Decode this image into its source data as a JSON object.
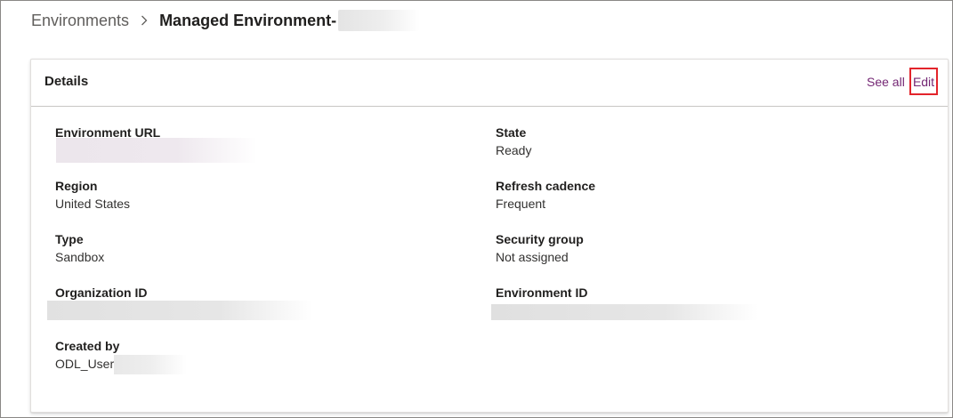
{
  "breadcrumb": {
    "root": "Environments",
    "separator_icon": "chevron-right-icon",
    "current": "Managed Environment-"
  },
  "card": {
    "title": "Details",
    "see_all_label": "See all",
    "edit_label": "Edit",
    "accent_color": "#742774",
    "highlight_color": "#e3242b"
  },
  "fields": {
    "environment_url": {
      "label": "Environment URL",
      "value": ""
    },
    "state": {
      "label": "State",
      "value": "Ready"
    },
    "region": {
      "label": "Region",
      "value": "United States"
    },
    "refresh_cadence": {
      "label": "Refresh cadence",
      "value": "Frequent"
    },
    "type": {
      "label": "Type",
      "value": "Sandbox"
    },
    "security_group": {
      "label": "Security group",
      "value": "Not assigned"
    },
    "organization_id": {
      "label": "Organization ID",
      "value": ""
    },
    "environment_id": {
      "label": "Environment ID",
      "value": ""
    },
    "created_by": {
      "label": "Created by",
      "value": "ODL_User"
    }
  }
}
